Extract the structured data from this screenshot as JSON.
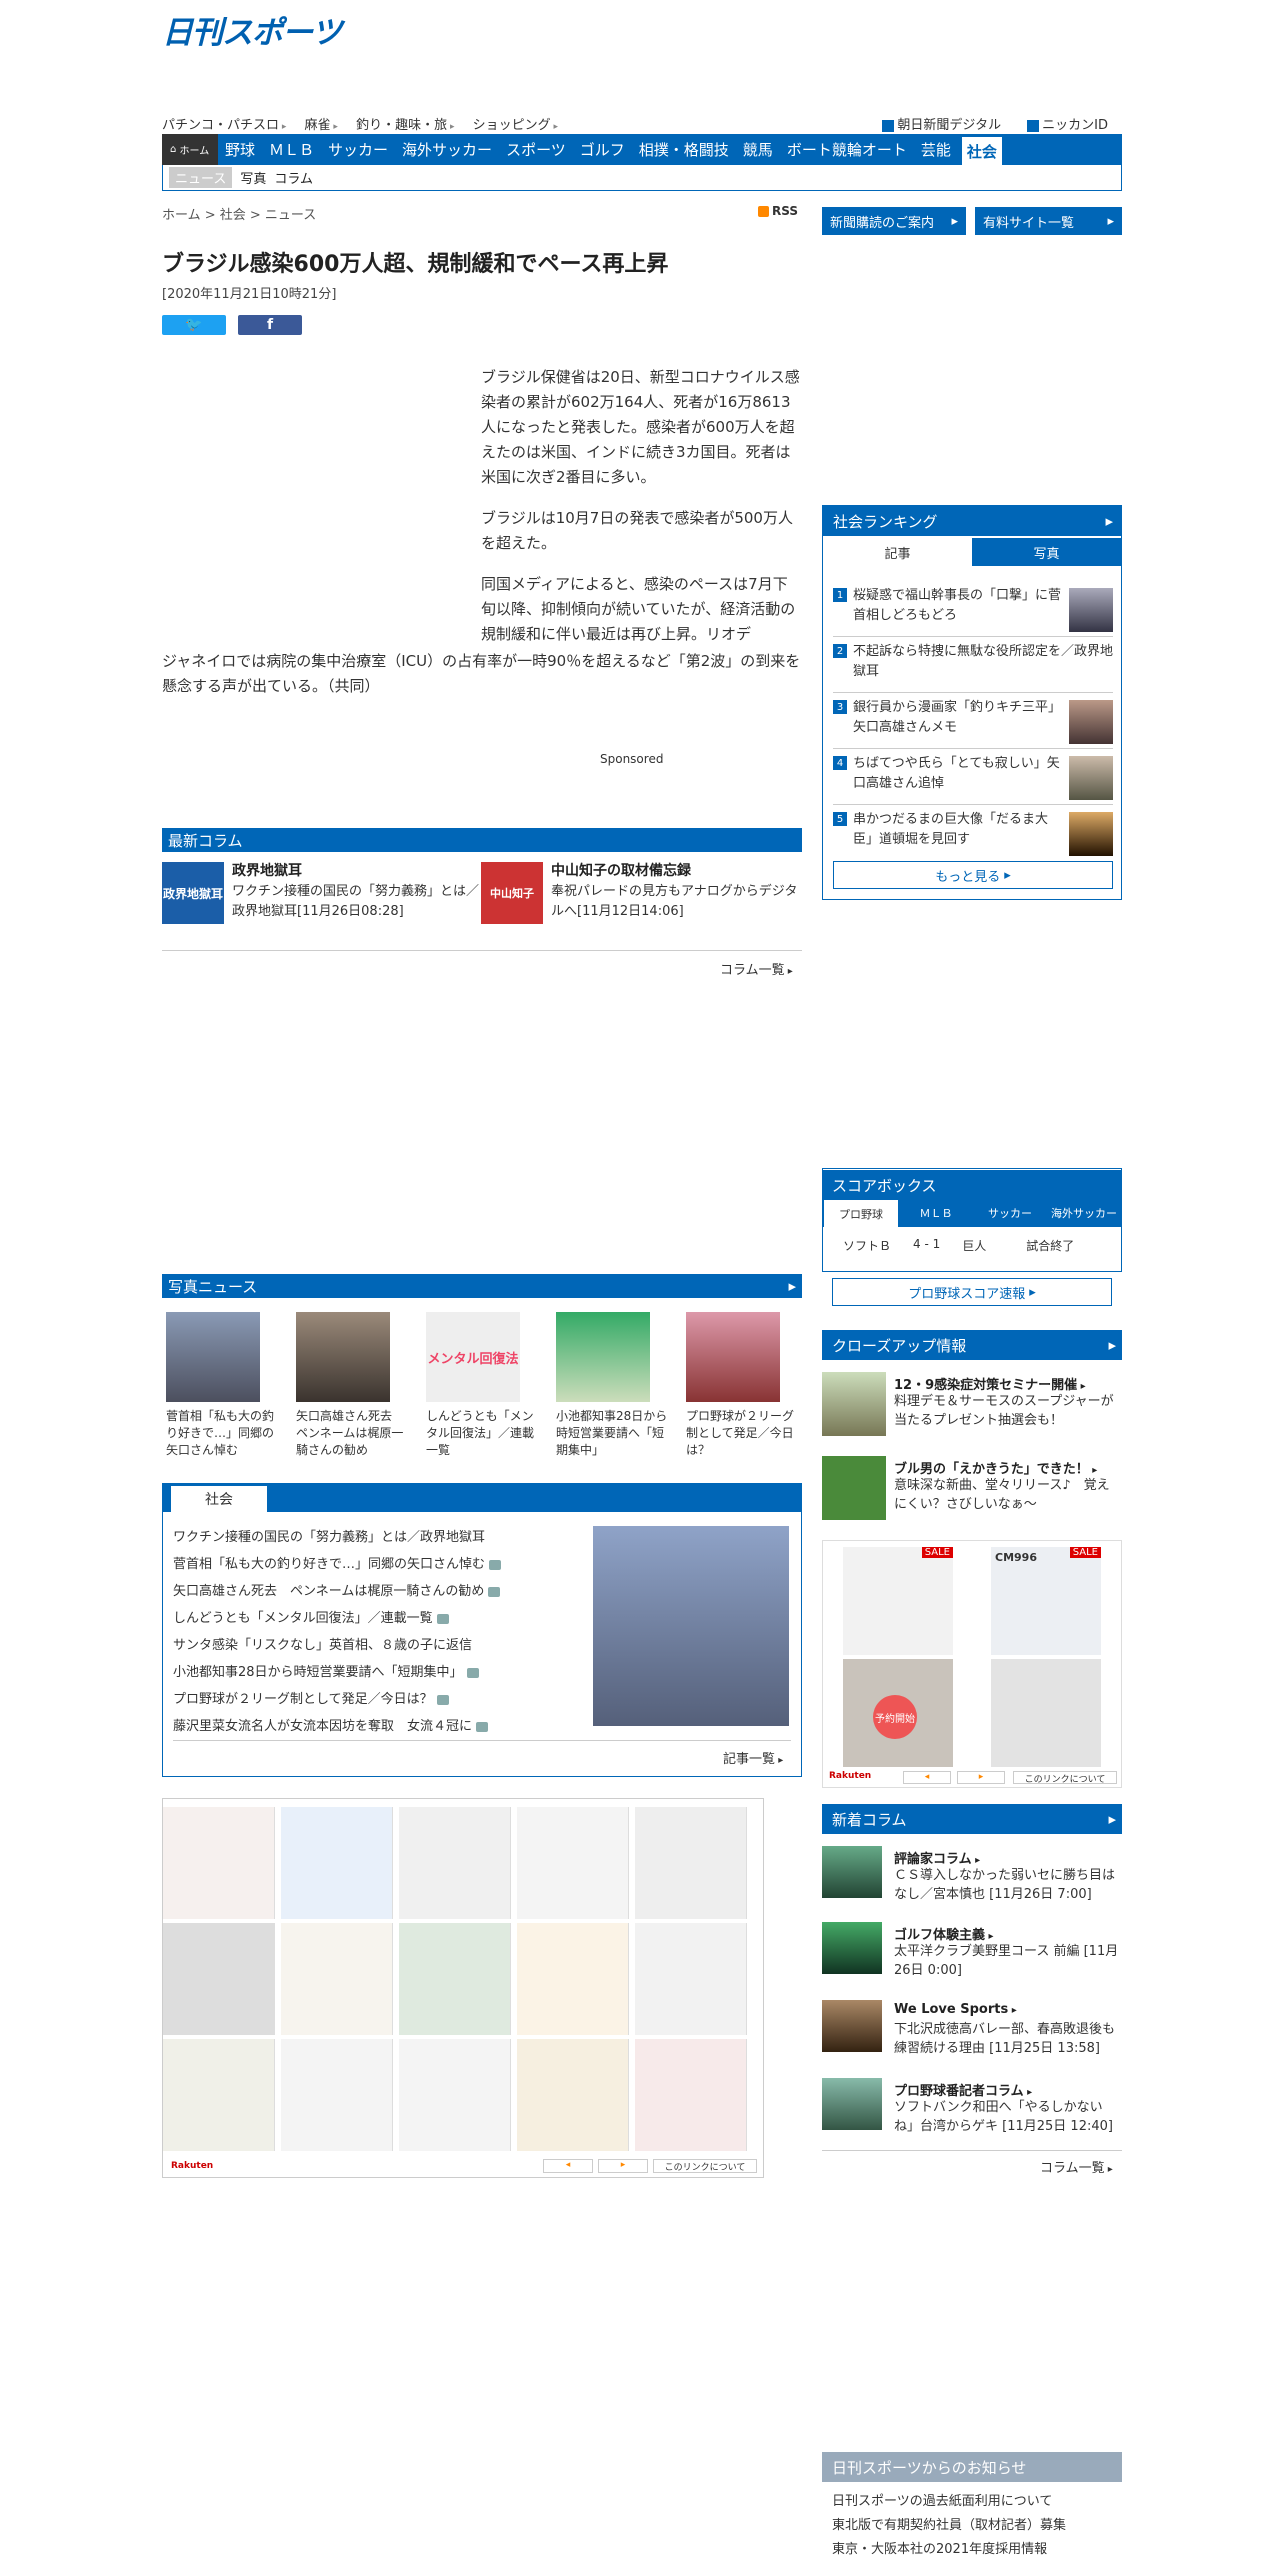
{
  "site": {
    "logo": "日刊スポーツ"
  },
  "subnav": {
    "items": [
      "パチンコ・パチスロ",
      "麻雀",
      "釣り・趣味・旅",
      "ショッピング"
    ],
    "right": [
      "朝日新聞デジタル",
      "ニッカンID"
    ]
  },
  "mainnav": {
    "home": "ホーム",
    "items": [
      "野球",
      "ＭＬＢ",
      "サッカー",
      "海外サッカー",
      "スポーツ",
      "ゴルフ",
      "相撲・格闘技",
      "競馬",
      "ボート競輪オート",
      "芸能"
    ],
    "active": "社会"
  },
  "catbar": {
    "current": "ニュース",
    "items": [
      "写真",
      "コラム"
    ]
  },
  "breadcrumb": "ホーム > 社会 > ニュース",
  "rss": "RSS",
  "side_buttons": [
    "新聞購読のご案内",
    "有料サイト一覧"
  ],
  "article": {
    "title": "ブラジル感染600万人超、規制緩和でペース再上昇",
    "date": "[2020年11月21日10時21分]",
    "p1": "ブラジル保健省は20日、新型コロナウイルス感染者の累計が602万164人、死者が16万8613人になったと発表した。感染者が600万人を超えたのは米国、インドに続き3カ国目。死者は米国に次ぎ2番目に多い。",
    "p2": "ブラジルは10月7日の発表で感染者が500万人を超えた。",
    "p3a": "同国メディアによると、感染のペースは7月下旬以降、抑制傾向が続いていたが、経済活動の規制緩和に伴い最近は再び上昇。リオデ",
    "p3b": "ジャネイロでは病院の集中治療室（ICU）の占有率が一時90％を超えるなど「第2波」の到来を懸念する声が出ている。（共同）"
  },
  "sponsored": "Sponsored",
  "latest_column": {
    "header": "最新コラム",
    "items": [
      {
        "img_text": "政界地獄耳",
        "title": "政界地獄耳",
        "text": "ワクチン接種の国民の「努力義務」とは／政界地獄耳[11月26日08:28]"
      },
      {
        "img_text": "中山知子",
        "title": "中山知子の取材備忘録",
        "text": "奉祝パレードの見方もアナログからデジタルへ[11月12日14:06]"
      }
    ],
    "more": "コラム一覧"
  },
  "photo_news": {
    "header": "写真ニュース",
    "items": [
      "菅首相「私も大の釣り好きで…」同郷の矢口さん悼む",
      "矢口高雄さん死去　ペンネームは梶原一騎さんの勧め",
      "しんどうとも「メンタル回復法」／連載一覧",
      "小池都知事28日から時短営業要請へ「短期集中」",
      "プロ野球が２リーグ制として発足／今日は？"
    ],
    "img_label": "メンタル回復法"
  },
  "society_box": {
    "tab": "社会",
    "items": [
      "ワクチン接種の国民の「努力義務」とは／政界地獄耳",
      "菅首相「私も大の釣り好きで…」同郷の矢口さん悼む",
      "矢口高雄さん死去　ペンネームは梶原一騎さんの勧め",
      "しんどうとも「メンタル回復法」／連載一覧",
      "サンタ感染「リスクなし」英首相、８歳の子に返信",
      "小池都知事28日から時短営業要請へ「短期集中」",
      "プロ野球が２リーグ制として発足／今日は？",
      "藤沢里菜女流名人が女流本因坊を奪取　女流４冠に"
    ],
    "more": "記事一覧"
  },
  "ad": {
    "footer": "Rakuten",
    "link": "このリンクについて"
  },
  "ranking": {
    "header": "社会ランキング",
    "tabs": [
      "記事",
      "写真"
    ],
    "items": [
      "桜疑惑で福山幹事長の「口撃」に菅首相しどろもどろ",
      "不起訴なら特捜に無駄な役所認定を／政界地獄耳",
      "銀行員から漫画家「釣りキチ三平」矢口高雄さんメモ",
      "ちばてつや氏ら「とても寂しい」矢口高雄さん追悼",
      "串かつだるまの巨大像「だるま大臣」道頓堀を見回す"
    ],
    "more": "もっと見る"
  },
  "scorebox": {
    "header": "スコアボックス",
    "tabs": [
      "プロ野球",
      "ＭＬＢ",
      "サッカー",
      "海外サッカー"
    ],
    "row": {
      "team1": "ソフトＢ",
      "score": "4 - 1",
      "team2": "巨人",
      "status": "試合終了"
    },
    "button": "プロ野球スコア速報"
  },
  "closeup": {
    "header": "クローズアップ情報",
    "items": [
      {
        "title": "12・9感染症対策セミナー開催",
        "text": "料理デモ＆サーモスのスープジャーが当たるプレゼント抽選会も！"
      },
      {
        "title": "ブル男の「えかきうた」できた！",
        "text": "意味深な新曲、堂々リリース♪　覚えにくい？さびしいなぁ～"
      }
    ],
    "shoe_labels": [
      "SALE",
      "CM996",
      "SALE",
      "予約開始"
    ]
  },
  "new_column": {
    "header": "新着コラム",
    "items": [
      {
        "title": "評論家コラム",
        "text": "ＣＳ導入しなかった弱いセに勝ち目はなし／宮本慎也 [11月26日 7:00]"
      },
      {
        "title": "ゴルフ体験主義",
        "text": "太平洋クラブ美野里コース 前編 [11月26日 0:00]"
      },
      {
        "title": "We Love Sports",
        "text": "下北沢成徳高バレー部、春高敗退後も練習続ける理由 [11月25日 13:58]"
      },
      {
        "title": "プロ野球番記者コラム",
        "text": "ソフトバンク和田へ「やるしかないね」台湾からゲキ [11月25日 12:40]"
      }
    ],
    "more": "コラム一覧"
  },
  "notice": {
    "header": "日刊スポーツからのお知らせ",
    "items": [
      "日刊スポーツの過去紙面利用について",
      "東北版で有期契約社員（取材記者）募集",
      "東京・大阪本社の2021年度採用情報"
    ]
  },
  "colors": {
    "brand": "#0066b7",
    "accent": "#003f8a"
  }
}
